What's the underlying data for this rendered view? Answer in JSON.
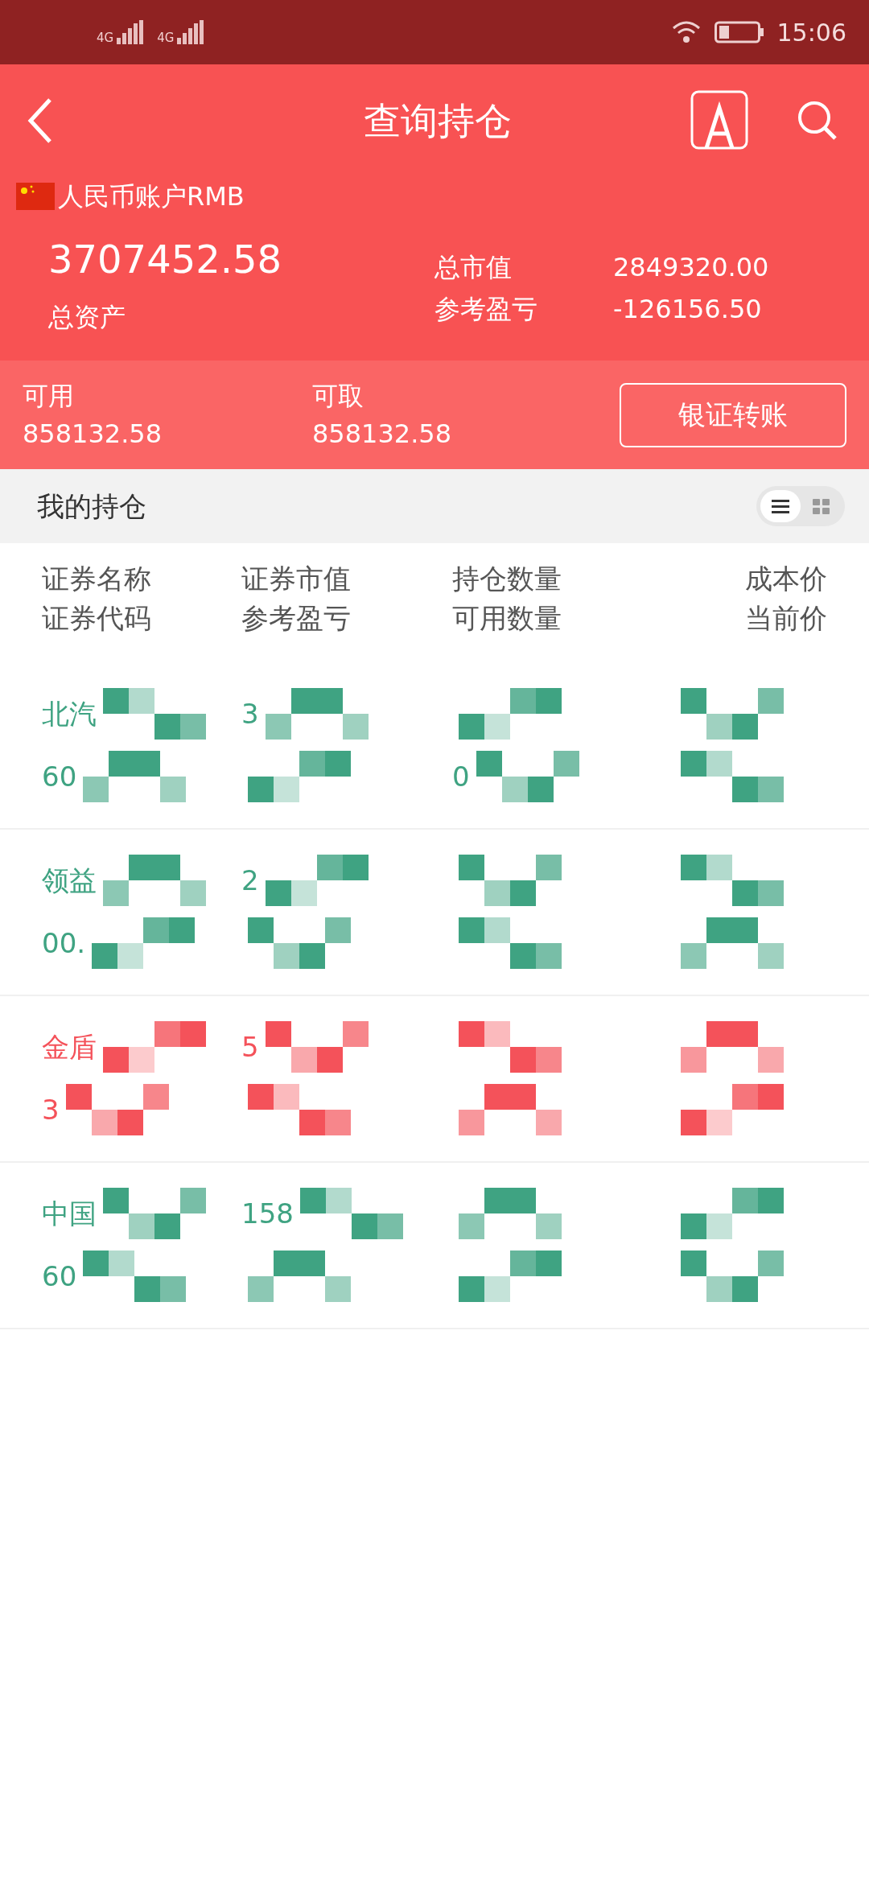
{
  "status_bar": {
    "network_1": "4G",
    "network_2": "4G",
    "time": "15:06"
  },
  "header": {
    "title": "查询持仓",
    "account": "人民币账户RMB",
    "total_assets": "3707452.58",
    "total_assets_label": "总资产",
    "summary": [
      {
        "label": "总市值",
        "value": "2849320.00"
      },
      {
        "label": "参考盈亏",
        "value": "-126156.50"
      }
    ]
  },
  "funds": [
    {
      "label": "可用",
      "value": "858132.58"
    },
    {
      "label": "可取",
      "value": "858132.58"
    }
  ],
  "transfer_button": "银证转账",
  "section": {
    "title": "我的持仓",
    "view_toggle": [
      {
        "kind": "list",
        "selected": true
      },
      {
        "kind": "grid",
        "selected": false
      }
    ]
  },
  "table": {
    "columns": [
      [
        "证券名称",
        "证券代码"
      ],
      [
        "证券市值",
        "参考盈亏"
      ],
      [
        "持仓数量",
        "可用数量"
      ],
      [
        "成本价",
        "当前价"
      ]
    ],
    "rows": [
      {
        "color": "#3fa382",
        "name": "北汽",
        "code": "60",
        "market_value": "3",
        "quantity": "0"
      },
      {
        "color": "#3fa382",
        "name": "领益",
        "code": "00.",
        "market_value": "2"
      },
      {
        "color": "#f4525a",
        "name": "金盾",
        "code": "3",
        "market_value": "5"
      },
      {
        "color": "#3fa382",
        "name": "中国",
        "code": "60",
        "market_value": "158"
      }
    ]
  }
}
